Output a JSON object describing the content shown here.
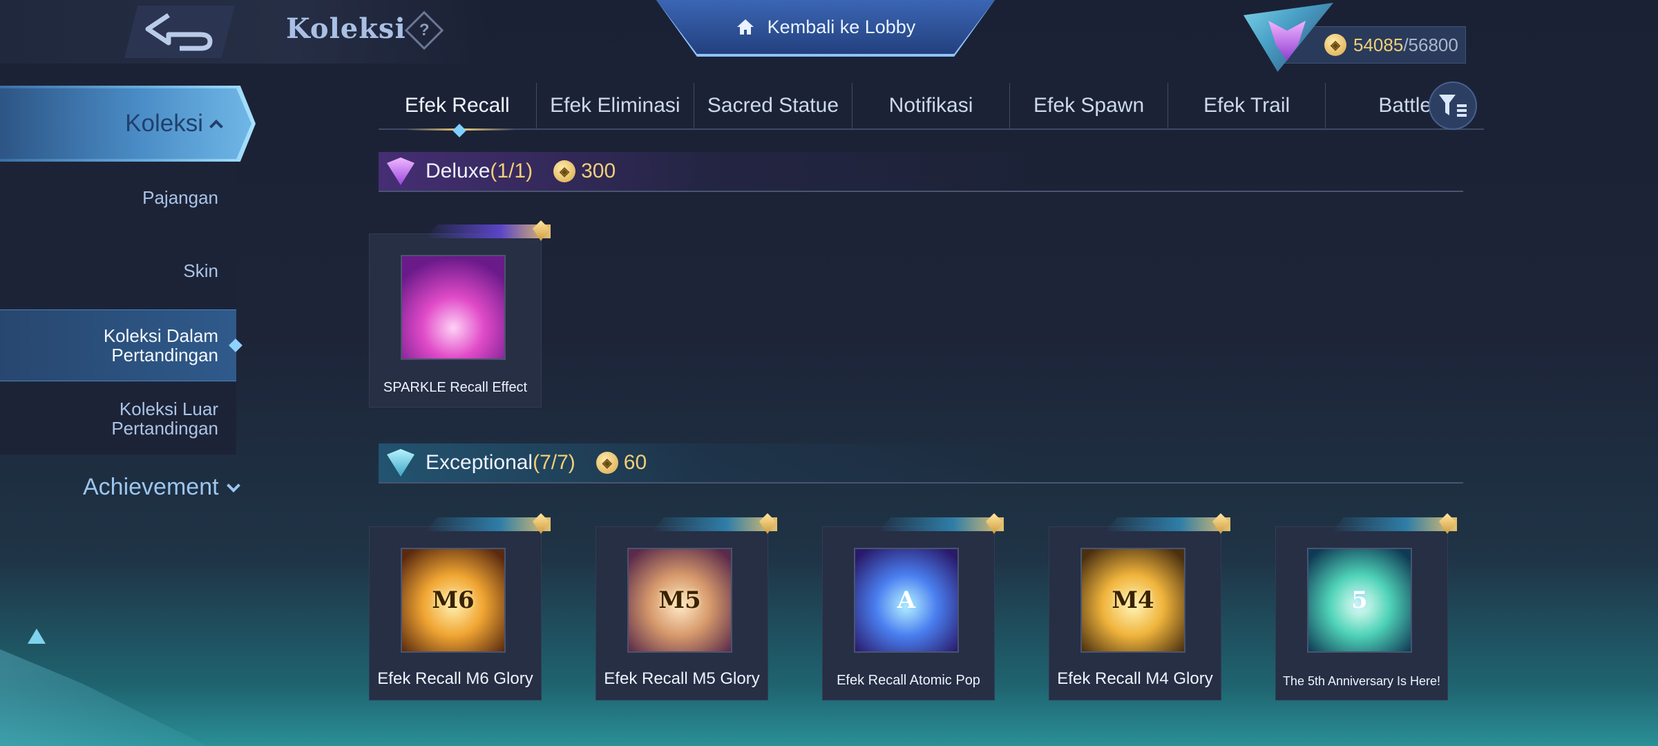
{
  "header": {
    "title": "Koleksi",
    "help_label": "?",
    "lobby_label": "Kembali ke Lobby"
  },
  "currency": {
    "current": "54085",
    "max": "/56800",
    "icon": "collection-coin-icon"
  },
  "sidebar": {
    "title": "Koleksi",
    "items": [
      {
        "label": "Pajangan",
        "active": false
      },
      {
        "label": "Skin",
        "active": false
      },
      {
        "label_line1": "Koleksi Dalam",
        "label_line2": "Pertandingan",
        "active": true
      },
      {
        "label_line1": "Koleksi Luar",
        "label_line2": "Pertandingan",
        "active": false
      }
    ],
    "achievement": "Achievement"
  },
  "tabs": [
    {
      "label": "Efek Recall",
      "active": true
    },
    {
      "label": "Efek Eliminasi",
      "active": false
    },
    {
      "label": "Sacred Statue",
      "active": false
    },
    {
      "label": "Notifikasi",
      "active": false
    },
    {
      "label": "Efek Spawn",
      "active": false
    },
    {
      "label": "Efek Trail",
      "active": false
    },
    {
      "label": "Battle",
      "active": false
    }
  ],
  "sections": {
    "deluxe": {
      "name": "Deluxe",
      "count": "(1/1)",
      "points": "300",
      "items": [
        {
          "name": "SPARKLE Recall Effect"
        }
      ]
    },
    "exceptional": {
      "name": "Exceptional",
      "count": "(7/7)",
      "points": "60",
      "items": [
        {
          "name": "Efek Recall M6 Glory",
          "emblem": "M6"
        },
        {
          "name": "Efek Recall M5 Glory",
          "emblem": "M5"
        },
        {
          "name": "Efek Recall Atomic Pop",
          "emblem": "A"
        },
        {
          "name": "Efek Recall M4 Glory",
          "emblem": "M4"
        },
        {
          "name": "The 5th Anniversary Is Here!",
          "emblem": "5"
        }
      ]
    }
  },
  "colors": {
    "accent_gold": "#f0cf78",
    "accent_blue": "#6ab0e0",
    "background": "#1d2438"
  }
}
